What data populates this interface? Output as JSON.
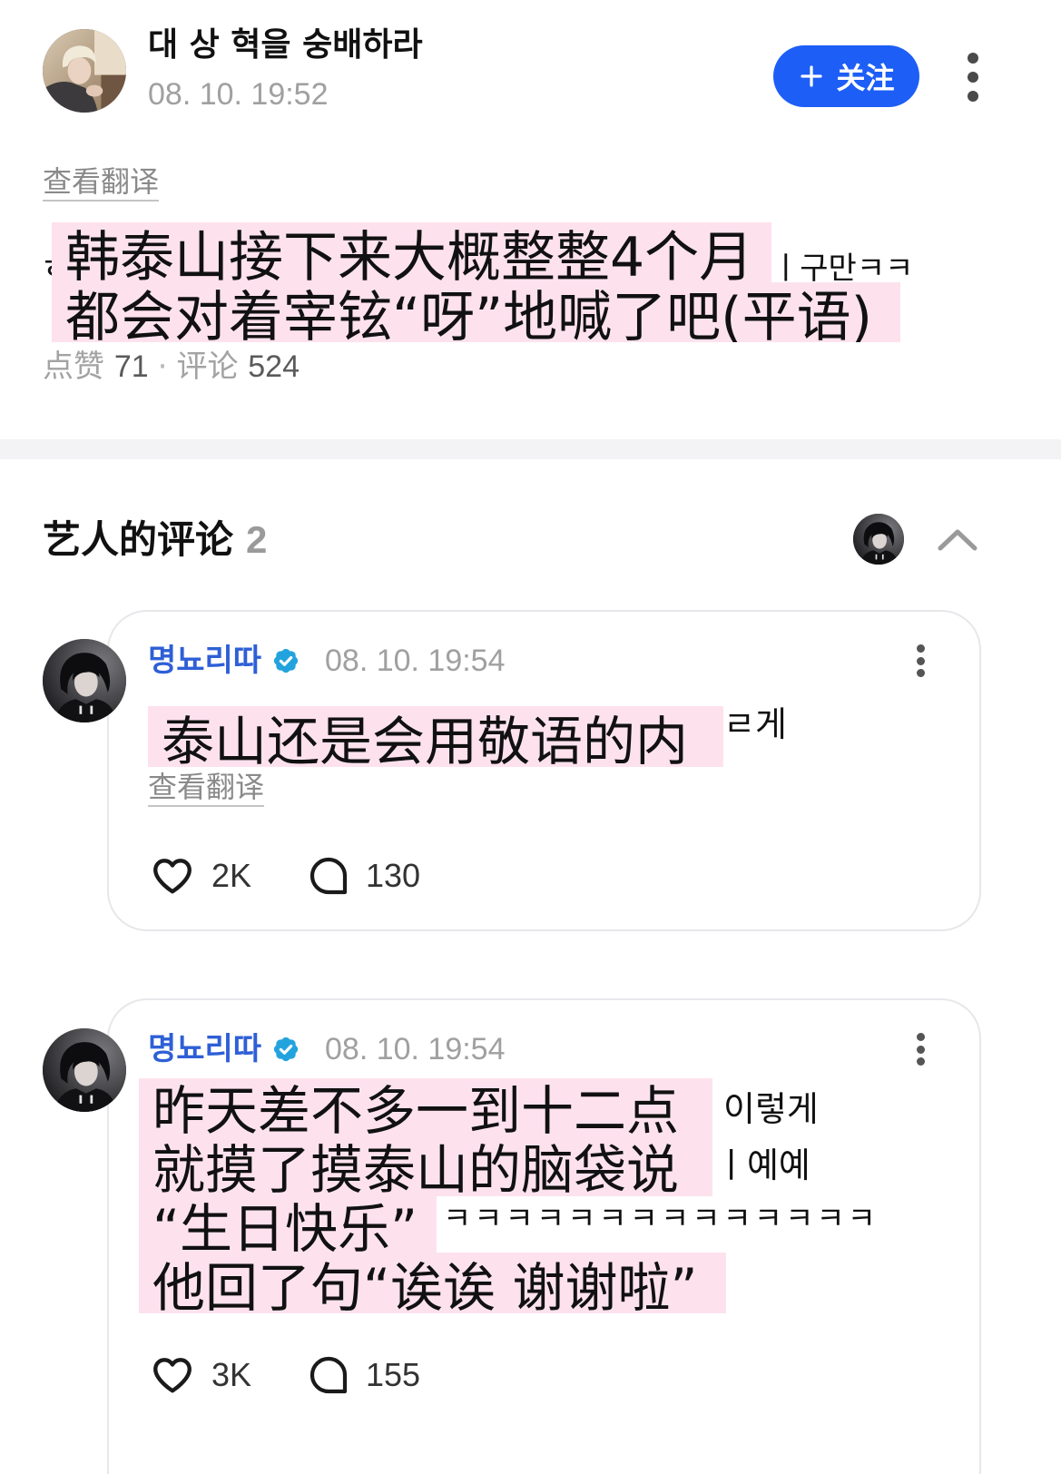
{
  "colors": {
    "accent": "#1d5ef6",
    "highlight": "#fde2ee",
    "artist_name": "#2e5fd6",
    "verified": "#23a3dd",
    "muted_text": "#a0a0a0",
    "divider": "#f3f3f5"
  },
  "post": {
    "author": {
      "name": "대 상 혁을 숭배하라",
      "avatar_icon": "author-avatar"
    },
    "timestamp": "08. 10. 19:52",
    "follow_button": {
      "icon": "plus-icon",
      "label": "关注"
    },
    "more_icon": "more-vertical-icon",
    "translate_label": "查看翻译",
    "original_fragments": [
      "ㅎ",
      "ㅣ구만ㅋㅋ"
    ],
    "translation_overlay": [
      "韩泰山接下来大概整整4个月",
      "都会对着宰铉“呀”地喊了吧(平语)"
    ],
    "stats": {
      "likes_label": "点赞",
      "likes": "71",
      "dot": "·",
      "comments_label": "评论",
      "comments": "524"
    }
  },
  "artist_comments": {
    "title": "艺人的评论",
    "count": "2",
    "collapse_icon": "chevron-up-icon",
    "items": [
      {
        "author": "명뇨리따",
        "verified_icon": "verified-badge-icon",
        "timestamp": "08. 10. 19:54",
        "more_icon": "more-vertical-icon",
        "original_fragments": [
          "ㄹ게"
        ],
        "translation_overlay": [
          "泰山还是会用敬语的内"
        ],
        "translate_label": "查看翻译",
        "like_icon": "heart-icon",
        "likes": "2K",
        "reply_icon": "comment-icon",
        "replies": "130"
      },
      {
        "author": "명뇨리따",
        "verified_icon": "verified-badge-icon",
        "timestamp": "08. 10. 19:54",
        "more_icon": "more-vertical-icon",
        "original_fragments": [
          "이렇게",
          "ㅣ예예",
          "ㅋㅋㅋㅋㅋㅋㅋㅋㅋㅋㅋㅋㅋㅋ"
        ],
        "translation_overlay": [
          "昨天差不多一到十二点",
          "就摸了摸泰山的脑袋说",
          "“生日快乐”",
          "他回了句“诶诶 谢谢啦”"
        ],
        "like_icon": "heart-icon",
        "likes": "3K",
        "reply_icon": "comment-icon",
        "replies": "155"
      }
    ]
  }
}
